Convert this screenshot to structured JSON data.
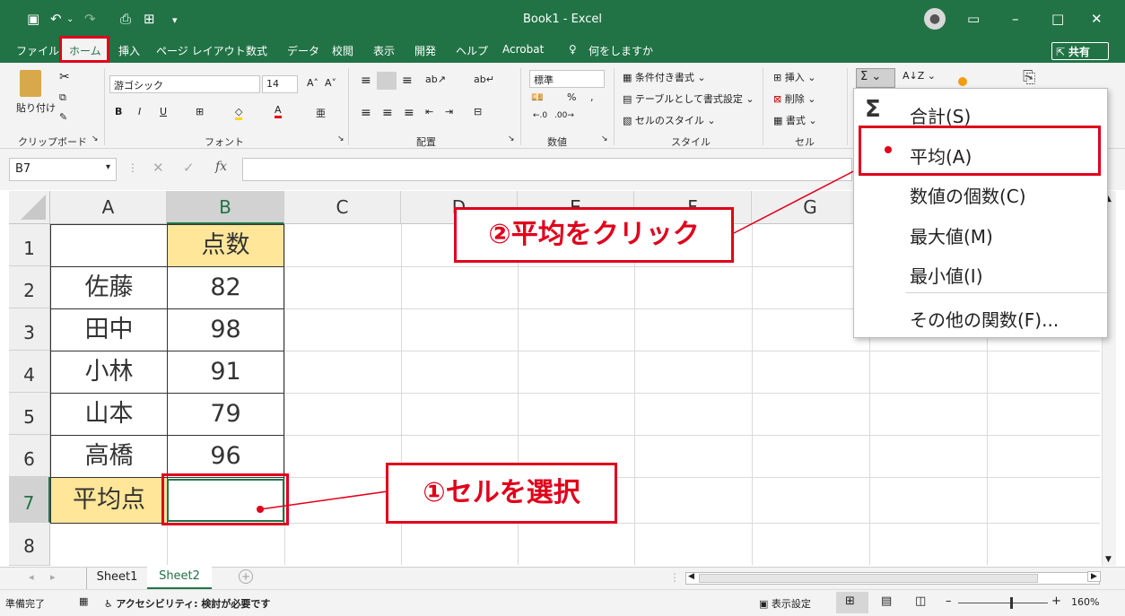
{
  "title": "Book1  -  Excel",
  "menu": [
    "ファイル",
    "ホーム",
    "挿入",
    "ページ レイアウト",
    "数式",
    "データ",
    "校閲",
    "表示",
    "開発",
    "ヘルプ",
    "Acrobat",
    "何をしますか"
  ],
  "share": "共有",
  "ribbon": {
    "clipboard": "クリップボード",
    "paste": "貼り付け",
    "font_group": "フォント",
    "font_name": "游ゴシック",
    "font_size": "14",
    "align_group": "配置",
    "number_group": "数値",
    "number_format": "標準",
    "style_group": "スタイル",
    "cond": "条件付き書式",
    "table": "テーブルとして書式設定",
    "cellstyle": "セルのスタイル",
    "cells_group": "セル",
    "insert": "挿入",
    "delete": "削除",
    "format": "書式"
  },
  "namebox": "B7",
  "fx": "fx",
  "columns": [
    "A",
    "B",
    "C",
    "D",
    "E",
    "F",
    "G"
  ],
  "rows": [
    "1",
    "2",
    "3",
    "4",
    "5",
    "6",
    "7",
    "8"
  ],
  "table": {
    "b1": "点数",
    "names": [
      "佐藤",
      "田中",
      "小林",
      "山本",
      "高橋"
    ],
    "scores": [
      "82",
      "98",
      "91",
      "79",
      "96"
    ],
    "a7": "平均点"
  },
  "dropdown": {
    "sigma": "Σ",
    "items": [
      "合計(S)",
      "平均(A)",
      "数値の個数(C)",
      "最大値(M)",
      "最小値(I)",
      "その他の関数(F)..."
    ]
  },
  "callouts": {
    "step1": "①セルを選択",
    "step2": "②平均をクリック"
  },
  "sheets": [
    "Sheet1",
    "Sheet2"
  ],
  "status": {
    "ready": "準備完了",
    "access": "アクセシビリティ: 検討が必要です",
    "display": "表示設定",
    "zoom": "160%"
  },
  "colors": {
    "excel_green": "#217346",
    "highlight": "#ffe699",
    "callout_red": "#e0001b"
  }
}
